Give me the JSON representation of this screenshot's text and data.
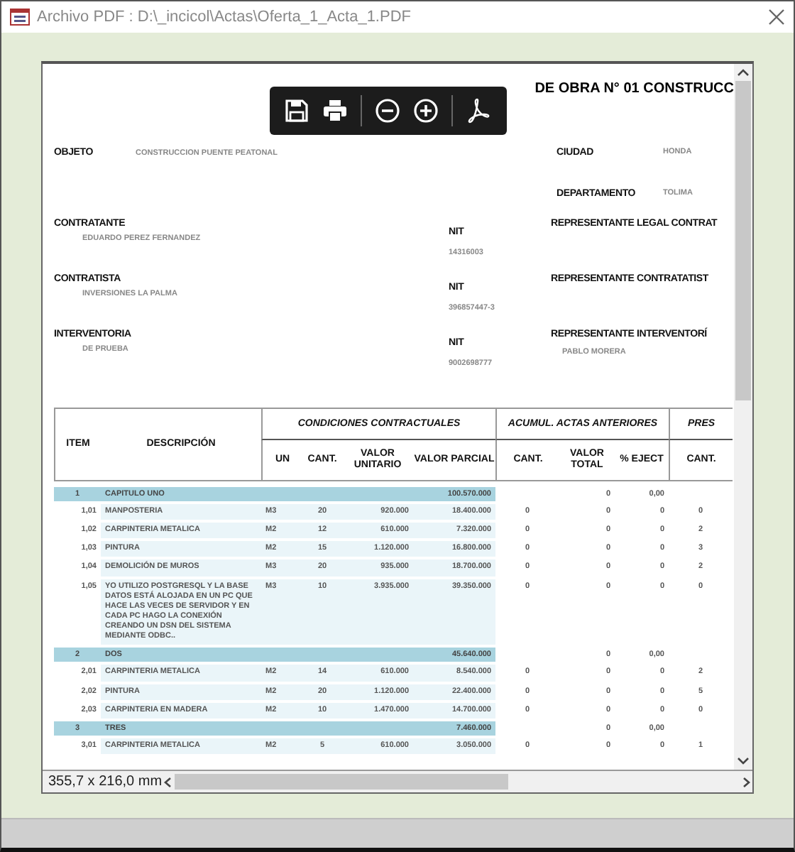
{
  "window": {
    "title": "Archivo PDF : D:\\_incicol\\Actas\\Oferta_1_Acta_1.PDF"
  },
  "report": {
    "title": "DE OBRA N° 01 CONSTRUCC",
    "objeto": {
      "label": "OBJETO",
      "value": "CONSTRUCCION  PUENTE PEATONAL"
    },
    "ciudad": {
      "label": "CIUDAD",
      "value": "HONDA"
    },
    "departamento": {
      "label": "DEPARTAMENTO",
      "value": "TOLIMA"
    },
    "parties": [
      {
        "label": "CONTRATANTE",
        "value": "EDUARDO PEREZ FERNANDEZ",
        "nit_label": "NIT",
        "nit": "14316003",
        "rep_label": "REPRESENTANTE LEGAL CONTRAT"
      },
      {
        "label": "CONTRATISTA",
        "value": "INVERSIONES LA PALMA",
        "nit_label": "NIT",
        "nit": "396857447-3",
        "rep_label": "REPRESENTANTE CONTRATATIST"
      },
      {
        "label": "INTERVENTORIA",
        "value": "DE PRUEBA",
        "nit_label": "NIT",
        "nit": "9002698777",
        "rep_label": "REPRESENTANTE INTERVENTORÍ",
        "rep": "PABLO MORERA"
      }
    ]
  },
  "table": {
    "columns": [
      {
        "label": "ITEM"
      },
      {
        "label": "DESCRIPCIÓN"
      },
      {
        "group": "CONDICIONES CONTRACTUALES",
        "columns": [
          "UN",
          "CANT.",
          "VALOR UNITARIO",
          "VALOR PARCIAL"
        ]
      },
      {
        "group": "ACUMUL. ACTAS ANTERIORES",
        "columns": [
          "CANT.",
          "VALOR TOTAL",
          "% EJECT"
        ]
      },
      {
        "group": "PRES",
        "columns": [
          "CANT."
        ]
      }
    ],
    "rows": [
      {
        "kind": "chapter",
        "item": "1",
        "description": "CAPITULO UNO",
        "parcial": "100.570.000",
        "acum_total": "0",
        "acum_pct": "0,00"
      },
      {
        "kind": "item",
        "item": "1,01",
        "description": "MANPOSTERIA",
        "un": "M3",
        "cant": "20",
        "unitario": "920.000",
        "parcial": "18.400.000",
        "acum_cant": "0",
        "acum_total": "0",
        "acum_pct": "0",
        "pres_cant": "0"
      },
      {
        "kind": "item",
        "item": "1,02",
        "description": "CARPINTERIA METALICA",
        "un": "M2",
        "cant": "12",
        "unitario": "610.000",
        "parcial": "7.320.000",
        "acum_cant": "0",
        "acum_total": "0",
        "acum_pct": "0",
        "pres_cant": "2"
      },
      {
        "kind": "item",
        "item": "1,03",
        "description": "PINTURA",
        "un": "M2",
        "cant": "15",
        "unitario": "1.120.000",
        "parcial": "16.800.000",
        "acum_cant": "0",
        "acum_total": "0",
        "acum_pct": "0",
        "pres_cant": "3"
      },
      {
        "kind": "item",
        "item": "1,04",
        "description": "DEMOLICIÓN DE MUROS",
        "un": "M3",
        "cant": "20",
        "unitario": "935.000",
        "parcial": "18.700.000",
        "acum_cant": "0",
        "acum_total": "0",
        "acum_pct": "0",
        "pres_cant": "2"
      },
      {
        "kind": "item",
        "item": "1,05",
        "description": "YO UTILIZO POSTGRESQL Y LA BASE DATOS ESTÁ ALOJADA EN UN PC QUE HACE LAS VECES DE SERVIDOR Y EN CADA PC HAGO LA CONEXIÓN CREANDO UN DSN DEL SISTEMA MEDIANTE ODBC..",
        "un": "M3",
        "cant": "10",
        "unitario": "3.935.000",
        "parcial": "39.350.000",
        "acum_cant": "0",
        "acum_total": "0",
        "acum_pct": "0",
        "pres_cant": "0"
      },
      {
        "kind": "chapter",
        "item": "2",
        "description": "DOS",
        "parcial": "45.640.000",
        "acum_total": "0",
        "acum_pct": "0,00"
      },
      {
        "kind": "item",
        "item": "2,01",
        "description": "CARPINTERIA METALICA",
        "un": "M2",
        "cant": "14",
        "unitario": "610.000",
        "parcial": "8.540.000",
        "acum_cant": "0",
        "acum_total": "0",
        "acum_pct": "0",
        "pres_cant": "2"
      },
      {
        "kind": "item",
        "item": "2,02",
        "description": "PINTURA",
        "un": "M2",
        "cant": "20",
        "unitario": "1.120.000",
        "parcial": "22.400.000",
        "acum_cant": "0",
        "acum_total": "0",
        "acum_pct": "0",
        "pres_cant": "5"
      },
      {
        "kind": "item",
        "item": "2,03",
        "description": "CARPINTERIA EN MADERA",
        "un": "M2",
        "cant": "10",
        "unitario": "1.470.000",
        "parcial": "14.700.000",
        "acum_cant": "0",
        "acum_total": "0",
        "acum_pct": "0",
        "pres_cant": "0"
      },
      {
        "kind": "chapter",
        "item": "3",
        "description": "TRES",
        "parcial": "7.460.000",
        "acum_total": "0",
        "acum_pct": "0,00"
      },
      {
        "kind": "item",
        "item": "3,01",
        "description": "CARPINTERIA METALICA",
        "un": "M2",
        "cant": "5",
        "unitario": "610.000",
        "parcial": "3.050.000",
        "acum_cant": "0",
        "acum_total": "0",
        "acum_pct": "0",
        "pres_cant": "1"
      }
    ]
  },
  "status_bar": {
    "page_size": "355,7 x 216,0 mm"
  }
}
